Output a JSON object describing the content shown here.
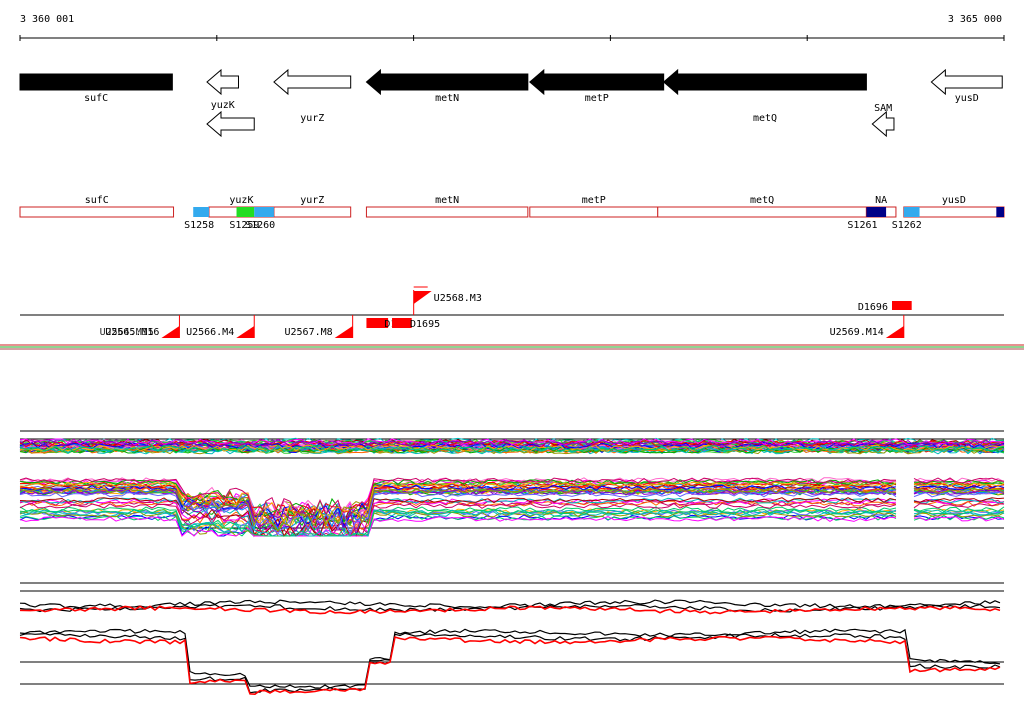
{
  "ruler": {
    "start_label": "3 360 001",
    "end_label": "3 365 000",
    "start": 3360001,
    "end": 3365000
  },
  "genes": [
    {
      "name": "sufC",
      "start": 3360001,
      "end": 3360775,
      "strand": "+",
      "filled": true,
      "row": 0
    },
    {
      "name": "yuzK",
      "start": 3360951,
      "end": 3361111,
      "strand": "-",
      "filled": false,
      "row": 0
    },
    {
      "name": "yurZ",
      "start": 3361291,
      "end": 3361681,
      "strand": "-",
      "filled": false,
      "row": 0
    },
    {
      "name": "metN",
      "start": 3361761,
      "end": 3362581,
      "strand": "-",
      "filled": true,
      "row": 0
    },
    {
      "name": "metP",
      "start": 3362591,
      "end": 3363271,
      "strand": "-",
      "filled": true,
      "row": 0
    },
    {
      "name": "metQ",
      "start": 3363271,
      "end": 3364301,
      "strand": "-",
      "filled": true,
      "row": 0
    },
    {
      "name": "yusD",
      "start": 3364631,
      "end": 3364991,
      "strand": "-",
      "filled": false,
      "row": 0
    },
    {
      "name": "",
      "start": 3360951,
      "end": 3361191,
      "strand": "-",
      "filled": false,
      "row": 1
    },
    {
      "name": "SAM",
      "start": 3364331,
      "end": 3364441,
      "strand": "-",
      "filled": false,
      "row": 1
    }
  ],
  "segments": [
    {
      "name": "sufC",
      "start": 3360001,
      "end": 3360781
    },
    {
      "name": "yuzK",
      "start": 3360961,
      "end": 3361291
    },
    {
      "name": "yurZ",
      "start": 3361291,
      "end": 3361681
    },
    {
      "name": "metN",
      "start": 3361761,
      "end": 3362581
    },
    {
      "name": "metP",
      "start": 3362591,
      "end": 3363241
    },
    {
      "name": "metQ",
      "start": 3363241,
      "end": 3364301
    },
    {
      "name": "NA",
      "start": 3364301,
      "end": 3364451
    },
    {
      "name": "yusD",
      "start": 3364491,
      "end": 3365000
    }
  ],
  "sites": [
    {
      "label": "S1258",
      "start": 3360881,
      "end": 3360961,
      "color": "#33aaee"
    },
    {
      "label": "S1259",
      "start": 3361101,
      "end": 3361191,
      "color": "#22dd22"
    },
    {
      "label": "S1260",
      "start": 3361191,
      "end": 3361291,
      "color": "#33aaee"
    },
    {
      "label": "S1261",
      "start": 3364301,
      "end": 3364401,
      "color": "#000088"
    },
    {
      "label": "S1262",
      "start": 3364491,
      "end": 3364571,
      "color": "#33aaee"
    },
    {
      "label": "",
      "start": 3364961,
      "end": 3365000,
      "color": "#000088"
    }
  ],
  "site_labels": [
    {
      "text": "S1258",
      "pos": 3360911
    },
    {
      "text": "S1259",
      "pos": 3361141
    },
    {
      "text": "S1260",
      "pos": 3361221
    },
    {
      "text": "S1261",
      "pos": 3364281
    },
    {
      "text": "S1262",
      "pos": 3364506
    }
  ],
  "features": [
    {
      "label": "U2568.M3",
      "start": 3362001,
      "end": 3362081,
      "side": "above",
      "flag": true
    },
    {
      "label": "D1696",
      "start": 3364431,
      "end": 3364531,
      "side": "above",
      "flag": false
    },
    {
      "label": "U2565.M16",
      "start": 3360681,
      "end": 3360811,
      "side": "below",
      "flag": true
    },
    {
      "label": "U2566.M4",
      "start": 3361111,
      "end": 3361191,
      "side": "below",
      "flag": true
    },
    {
      "label": "U2567.M8",
      "start": 3361611,
      "end": 3361691,
      "side": "below",
      "flag": true
    },
    {
      "label": "U2569.M14",
      "start": 3364441,
      "end": 3364491,
      "side": "below",
      "flag": true
    },
    {
      "label": "D1",
      "start": 3361761,
      "end": 3361871,
      "side": "on",
      "flag": false
    },
    {
      "label": "D1695",
      "start": 3361891,
      "end": 3361991,
      "side": "on",
      "flag": false
    },
    {
      "label": "U2564.M15",
      "start": 3360621,
      "end": 3360701,
      "side": "below-hidden",
      "flag": false
    }
  ],
  "colors": {
    "gene_fill": "#000000",
    "segment_border": "#cc2222",
    "feature": "#ff0000",
    "axis": "#000000"
  }
}
